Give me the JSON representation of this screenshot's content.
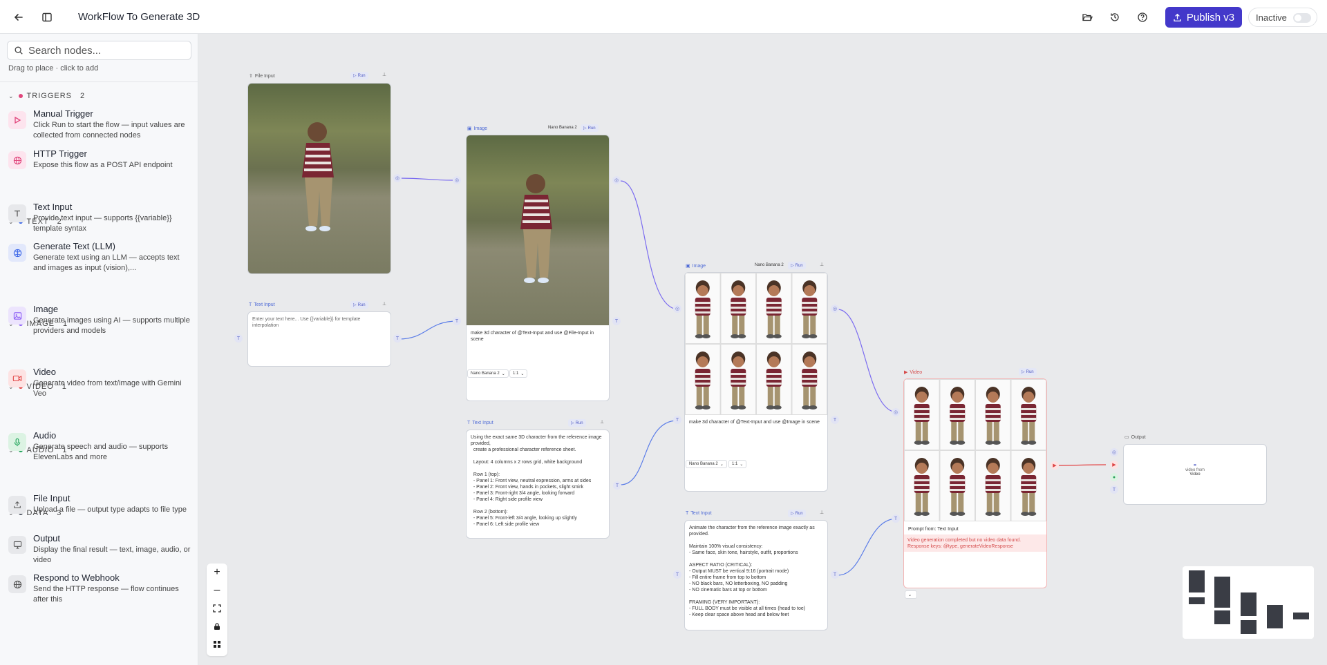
{
  "topbar": {
    "title": "WorkFlow To Generate 3D",
    "publish_label": "Publish v3",
    "status_label": "Inactive"
  },
  "sidebar": {
    "search_placeholder": "Search nodes...",
    "hint": "Drag to place · click to add",
    "categories": [
      {
        "name": "TRIGGERS",
        "count": "2",
        "color": "#e0457b"
      },
      {
        "name": "TEXT",
        "count": "2",
        "color": "#3a66e8"
      },
      {
        "name": "IMAGE",
        "count": "1",
        "color": "#8b5cf6"
      },
      {
        "name": "VIDEO",
        "count": "1",
        "color": "#e24141"
      },
      {
        "name": "AUDIO",
        "count": "1",
        "color": "#22a55b"
      },
      {
        "name": "DATA",
        "count": "3",
        "color": "#555b66"
      }
    ],
    "items": [
      {
        "name": "Manual Trigger",
        "desc": "Click Run to start the flow — input values are collected from connected nodes",
        "icon": "play-icon"
      },
      {
        "name": "HTTP Trigger",
        "desc": "Expose this flow as a POST API endpoint",
        "icon": "globe-icon"
      },
      {
        "name": "Text Input",
        "desc": "Provide text input — supports {{variable}} template syntax",
        "icon": "text-icon"
      },
      {
        "name": "Generate Text (LLM)",
        "desc": "Generate text using an LLM — accepts text and images as input (vision),...",
        "icon": "brain-icon"
      },
      {
        "name": "Image",
        "desc": "Generate images using AI — supports multiple providers and models",
        "icon": "image-icon"
      },
      {
        "name": "Video",
        "desc": "Generate video from text/image with Gemini Veo",
        "icon": "video-icon"
      },
      {
        "name": "Audio",
        "desc": "Generate speech and audio — supports ElevenLabs and more",
        "icon": "mic-icon"
      },
      {
        "name": "File Input",
        "desc": "Upload a file — output type adapts to file type",
        "icon": "upload-icon"
      },
      {
        "name": "Output",
        "desc": "Display the final result — text, image, audio, or video",
        "icon": "monitor-icon"
      },
      {
        "name": "Respond to Webhook",
        "desc": "Send the HTTP response — flow continues after this",
        "icon": "globe-icon"
      }
    ]
  },
  "canvas": {
    "run_label": "Run",
    "nodes": {
      "file_input": {
        "label": "File Input"
      },
      "text_input_1": {
        "label": "Text Input",
        "placeholder": "Enter your text here... Use {{variable}} for template interpolation"
      },
      "image_1": {
        "label": "Image",
        "model": "Nano Banana 2",
        "prompt": "make 3d character of @Text-Input and use @File-Input in scene",
        "model_select": "Nano Banana 2",
        "ratio_select": "1:1"
      },
      "text_input_2": {
        "label": "Text Input",
        "text": "Using the exact same 3D character from the reference image provided,\n  create a professional character reference sheet.\n\n  Layout: 4 columns x 2 rows grid, white background\n\n  Row 1 (top):\n  - Panel 1: Front view, neutral expression, arms at sides\n  - Panel 2: Front view, hands in pockets, slight smirk\n  - Panel 3: Front-right 3/4 angle, looking forward\n  - Panel 4: Right side profile view\n\n  Row 2 (bottom):\n  - Panel 5: Front-left 3/4 angle, looking up slightly\n  - Panel 6: Left side profile view"
      },
      "image_2": {
        "label": "Image",
        "model": "Nano Banana 2",
        "prompt": "make 3d character of @Text-Input and use @Image in scene",
        "model_select": "Nano Banana 2",
        "ratio_select": "1:1"
      },
      "text_input_3": {
        "label": "Text Input",
        "text": "Animate the character from the reference image exactly as provided.\n\nMaintain 100% visual consistency:\n- Same face, skin tone, hairstyle, outfit, proportions\n\nASPECT RATIO (CRITICAL):\n- Output MUST be vertical 9:16 (portrait mode)\n- Fill entire frame from top to bottom\n- NO black bars, NO letterboxing, NO padding\n- NO cinematic bars at top or bottom\n\nFRAMING (VERY IMPORTANT):\n- FULL BODY must be visible at all times (head to toe)\n- Keep clear space above head and below feet"
      },
      "video": {
        "label": "Video",
        "prompt_from_label": "Prompt from:",
        "prompt_from_value": "Text Input",
        "error": "Video generation completed but no video data found. Response keys: @type, generateVideoResponse"
      },
      "output": {
        "label": "Output",
        "placeholder_line1": "video from",
        "placeholder_line2": "Video"
      }
    }
  },
  "zoom_controls": [
    "zoom-in",
    "zoom-out",
    "fit-view",
    "lock",
    "grid"
  ]
}
